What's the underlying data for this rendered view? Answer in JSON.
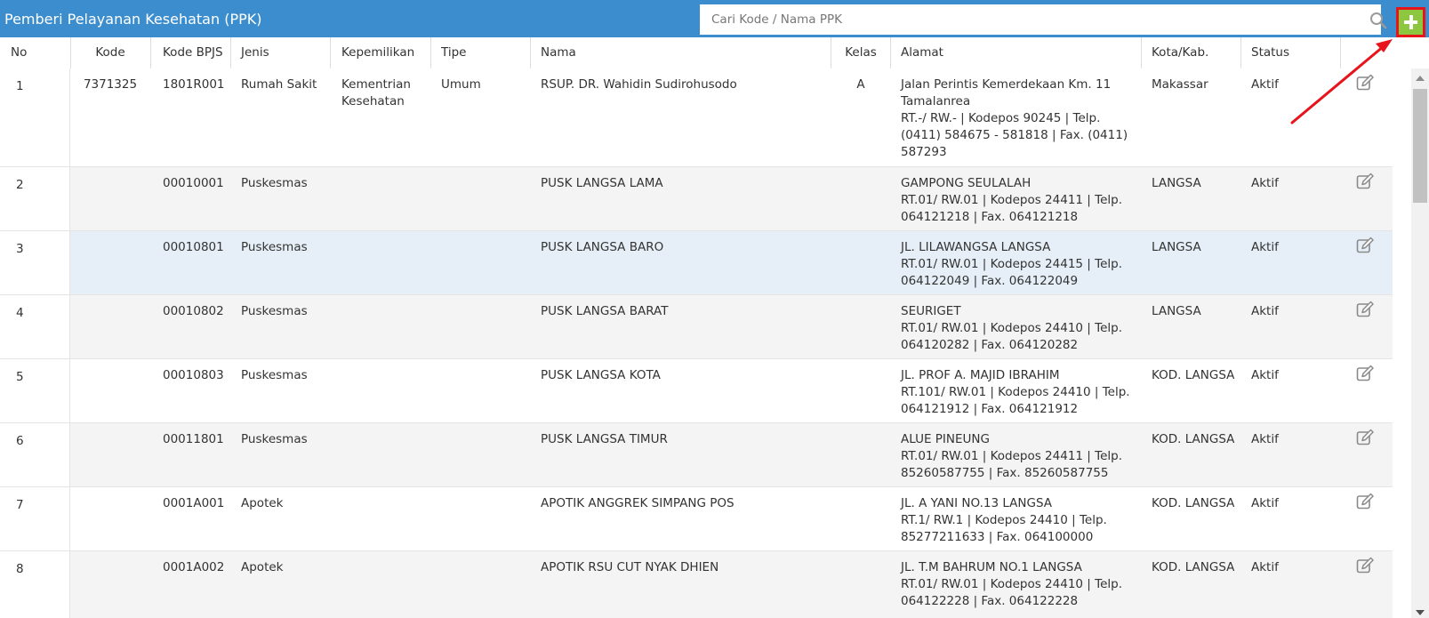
{
  "header": {
    "title": "Pemberi Pelayanan Kesehatan (PPK)",
    "search_placeholder": "Cari Kode / Nama PPK"
  },
  "table": {
    "columns": [
      "No",
      "Kode",
      "Kode BPJS",
      "Jenis",
      "Kepemilikan",
      "Tipe",
      "Nama",
      "Kelas",
      "Alamat",
      "Kota/Kab.",
      "Status"
    ],
    "rows": [
      {
        "no": "1",
        "kode": "7371325",
        "bpjs": "1801R001",
        "jenis": "Rumah Sakit",
        "kepemilikan": [
          "Kementrian",
          "Kesehatan"
        ],
        "tipe": "Umum",
        "nama": "RSUP. DR. Wahidin Sudirohusodo",
        "kelas": "A",
        "alamat": [
          "Jalan Perintis Kemerdekaan Km. 11",
          "Tamalanrea",
          "RT.-/ RW.- | Kodepos 90245 | Telp.",
          "(0411) 584675 - 581818 | Fax. (0411)",
          "587293"
        ],
        "kota": "Makassar",
        "status": "Aktif"
      },
      {
        "no": "2",
        "kode": "",
        "bpjs": "00010001",
        "jenis": "Puskesmas",
        "kepemilikan": [],
        "tipe": "",
        "nama": "PUSK LANGSA LAMA",
        "kelas": "",
        "alamat": [
          "GAMPONG SEULALAH",
          "RT.01/ RW.01 | Kodepos 24411 | Telp.",
          "064121218 | Fax. 064121218"
        ],
        "kota": "LANGSA",
        "status": "Aktif"
      },
      {
        "no": "3",
        "kode": "",
        "bpjs": "00010801",
        "jenis": "Puskesmas",
        "kepemilikan": [],
        "tipe": "",
        "nama": "PUSK LANGSA BARO",
        "kelas": "",
        "alamat": [
          "JL. LILAWANGSA LANGSA",
          "RT.01/ RW.01 | Kodepos 24415 | Telp.",
          "064122049 | Fax. 064122049"
        ],
        "kota": "LANGSA",
        "status": "Aktif"
      },
      {
        "no": "4",
        "kode": "",
        "bpjs": "00010802",
        "jenis": "Puskesmas",
        "kepemilikan": [],
        "tipe": "",
        "nama": "PUSK LANGSA BARAT",
        "kelas": "",
        "alamat": [
          "SEURIGET",
          "RT.01/ RW.01 | Kodepos 24410 | Telp.",
          "064120282 | Fax. 064120282"
        ],
        "kota": "LANGSA",
        "status": "Aktif"
      },
      {
        "no": "5",
        "kode": "",
        "bpjs": "00010803",
        "jenis": "Puskesmas",
        "kepemilikan": [],
        "tipe": "",
        "nama": "PUSK LANGSA KOTA",
        "kelas": "",
        "alamat": [
          "JL. PROF A. MAJID IBRAHIM",
          "RT.101/ RW.01 | Kodepos 24410 | Telp.",
          "064121912 | Fax. 064121912"
        ],
        "kota": "KOD. LANGSA",
        "status": "Aktif"
      },
      {
        "no": "6",
        "kode": "",
        "bpjs": "00011801",
        "jenis": "Puskesmas",
        "kepemilikan": [],
        "tipe": "",
        "nama": "PUSK LANGSA TIMUR",
        "kelas": "",
        "alamat": [
          "ALUE PINEUNG",
          "RT.01/ RW.01 | Kodepos 24411 | Telp.",
          "85260587755 | Fax. 85260587755"
        ],
        "kota": "KOD. LANGSA",
        "status": "Aktif"
      },
      {
        "no": "7",
        "kode": "",
        "bpjs": "0001A001",
        "jenis": "Apotek",
        "kepemilikan": [],
        "tipe": "",
        "nama": "APOTIK ANGGREK SIMPANG POS",
        "kelas": "",
        "alamat": [
          "JL. A YANI NO.13 LANGSA",
          "RT.1/ RW.1 | Kodepos 24410 | Telp.",
          "85277211633 | Fax. 064100000"
        ],
        "kota": "KOD. LANGSA",
        "status": "Aktif"
      },
      {
        "no": "8",
        "kode": "",
        "bpjs": "0001A002",
        "jenis": "Apotek",
        "kepemilikan": [],
        "tipe": "",
        "nama": "APOTIK RSU CUT NYAK DHIEN",
        "kelas": "",
        "alamat": [
          "JL. T.M BAHRUM NO.1 LANGSA",
          "RT.01/ RW.01 | Kodepos 24410 | Telp.",
          "064122228 | Fax. 064122228"
        ],
        "kota": "KOD. LANGSA",
        "status": "Aktif"
      }
    ]
  },
  "icons": {
    "search": "search-icon",
    "add": "plus-icon",
    "edit": "edit-icon"
  },
  "colors": {
    "header_bg": "#3c8dcd",
    "add_button_bg": "#8dc63f",
    "annotation_red": "#e8141b",
    "row_alt_bg": "#f4f4f4",
    "row_hover_bg": "#e6eff7"
  }
}
